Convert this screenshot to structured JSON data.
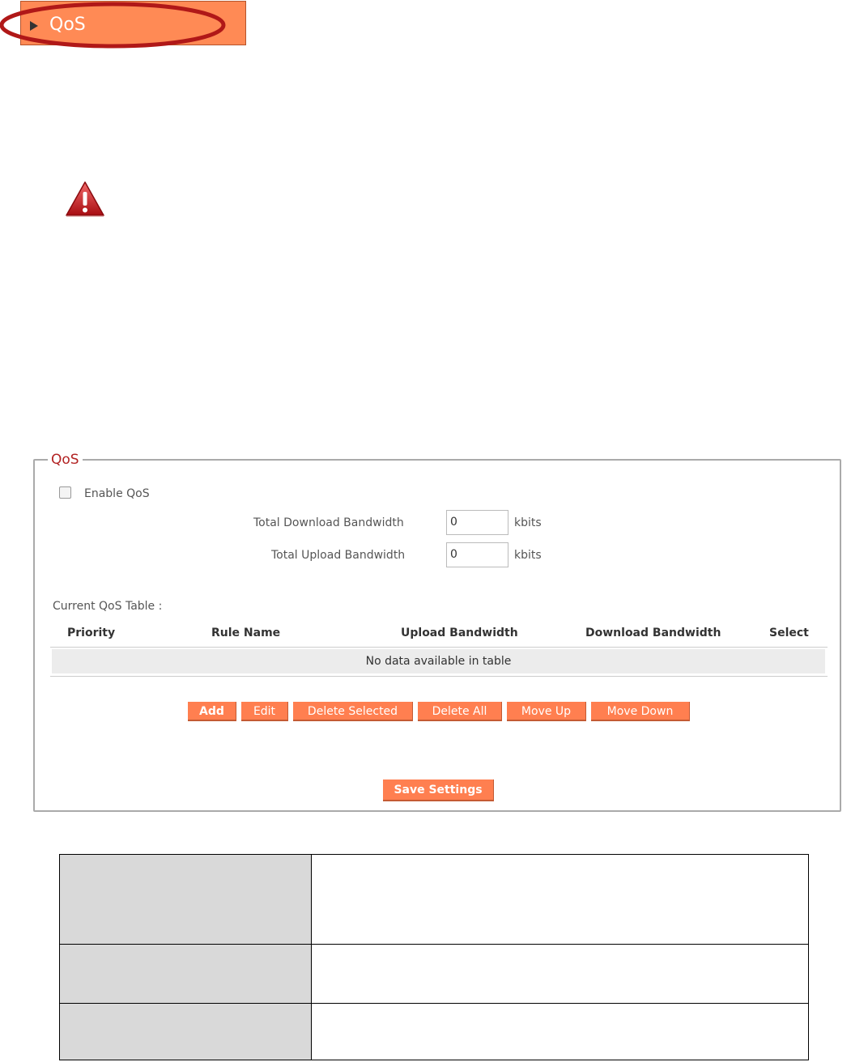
{
  "header": {
    "title": "QoS"
  },
  "qos_panel": {
    "legend": "QoS",
    "enable_label": "Enable  QoS",
    "enable_checked": false,
    "total_download_label": "Total Download Bandwidth",
    "total_download_value": "0",
    "total_upload_label": "Total Upload Bandwidth",
    "total_upload_value": "0",
    "unit": "kbits",
    "table_title": "Current QoS Table :",
    "columns": [
      "Priority",
      "Rule Name",
      "Upload Bandwidth",
      "Download Bandwidth",
      "Select"
    ],
    "empty_text": "No data available in table",
    "buttons": {
      "add": "Add",
      "edit": "Edit",
      "delete_selected": "Delete Selected",
      "delete_all": "Delete All",
      "move_up": "Move Up",
      "move_down": "Move Down"
    },
    "save_label": "Save Settings"
  },
  "colors": {
    "accent": "#ff7f50",
    "highlight_ring": "#b01818",
    "legend_text": "#b22222"
  },
  "icons": {
    "warning": "warning-triangle-icon",
    "arrow": "triangle-right-icon"
  }
}
